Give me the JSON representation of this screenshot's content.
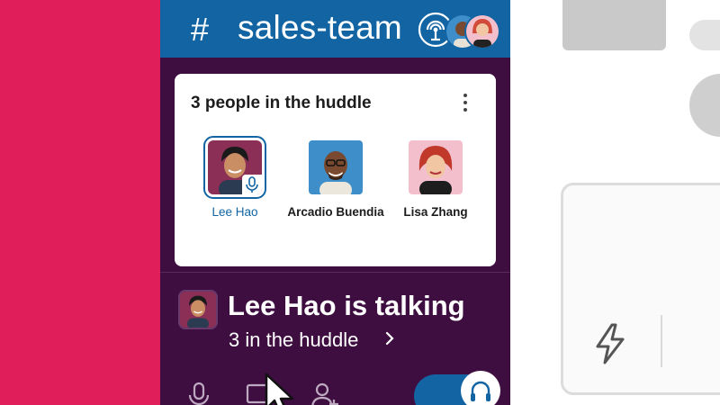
{
  "channel": {
    "hash": "#",
    "name": "sales-team"
  },
  "huddle_popup": {
    "title": "3 people in the huddle",
    "participants": [
      {
        "name": "Lee Hao",
        "active": true
      },
      {
        "name": "Arcadio Buendia",
        "active": false
      },
      {
        "name": "Lisa Zhang",
        "active": false
      }
    ]
  },
  "talking_banner": {
    "title": "Lee Hao is talking",
    "subtitle": "3 in the huddle"
  },
  "controls": {
    "headphones_toggle_on": true
  },
  "colors": {
    "brand_pink": "#e01e5a",
    "header_blue": "#1264a3",
    "sidebar_aubergine": "#3f0e40",
    "active_name": "#1264a3"
  },
  "icons": [
    "huddle-headphones-icon",
    "more-vertical-icon",
    "microphone-icon",
    "chevron-right-icon",
    "screen-share-icon",
    "add-person-icon",
    "headphones-icon",
    "lightning-bolt-icon",
    "mouse-pointer-icon"
  ]
}
